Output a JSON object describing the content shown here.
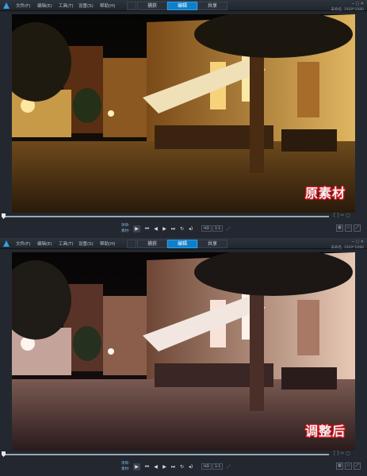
{
  "menu": {
    "items": [
      "文件(F)",
      "编辑(E)",
      "工具(T)",
      "设置(S)",
      "帮助(H)"
    ]
  },
  "tabs": {
    "items": [
      "捕获",
      "编辑",
      "共享"
    ],
    "active_index": 1
  },
  "window": {
    "project_label": "未命名, 1920*1080"
  },
  "player": {
    "mode_labels": [
      "项目-",
      "素材-"
    ],
    "hd_label": "HD",
    "zoom_label": "1:1",
    "position_fraction": 0.0
  },
  "panels": [
    {
      "overlay_label": "原素材"
    },
    {
      "overlay_label": "调整后"
    }
  ],
  "colors": {
    "accent": "#0f7fc7",
    "overlay_outline": "#c8141e"
  },
  "icons": {
    "play": "play-icon",
    "previous": "step-back-icon",
    "next": "step-forward-icon",
    "repeat": "repeat-icon",
    "volume": "volume-icon"
  }
}
